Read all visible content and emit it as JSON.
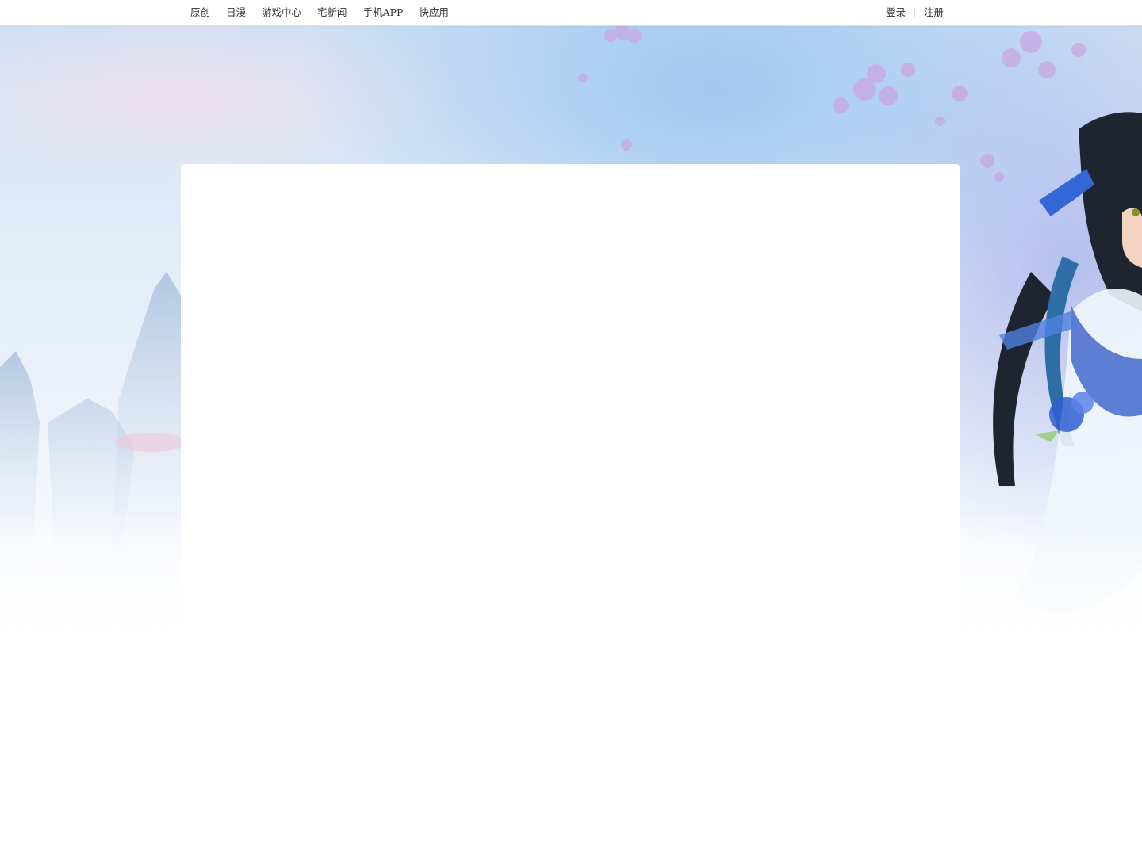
{
  "topbar": {
    "nav": [
      {
        "label": "原创"
      },
      {
        "label": "日漫"
      },
      {
        "label": "游戏中心"
      },
      {
        "label": "宅新闻"
      },
      {
        "label": "手机APP"
      },
      {
        "label": "快应用"
      }
    ],
    "auth": {
      "login_label": "登录",
      "register_label": "注册"
    }
  },
  "hero": {
    "colors": {
      "sky": "#cfe0f4",
      "blossom": "#c9a7e0",
      "ribbon": "#2f5fd0",
      "hair": "#1e2430"
    }
  }
}
